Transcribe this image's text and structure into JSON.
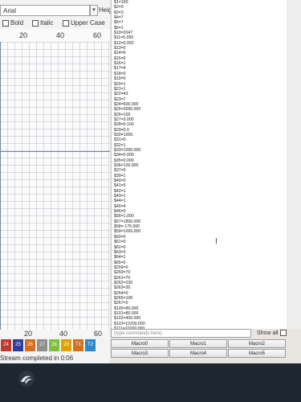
{
  "toolbar": {
    "font_value": "Arial",
    "dropdown_glyph": "▾",
    "height_label": "Heigh",
    "bold_label": "Bold",
    "italic_label": "Italic",
    "uppercase_label": "Upper Case"
  },
  "ruler": {
    "top_ticks": [
      "20",
      "40",
      "60"
    ],
    "bottom_ticks": [
      "20",
      "40",
      "60"
    ]
  },
  "tools": [
    "24",
    "25",
    "26",
    "27",
    "28",
    "29",
    "T1",
    "T2"
  ],
  "tool_colors": [
    "#c0392b",
    "#2d3e9e",
    "#d96b1d",
    "#8e8e8e",
    "#7fbf3f",
    "#e0a000",
    "#d07020",
    "#2f89c9"
  ],
  "status": "Stream completed in 0:06",
  "console": {
    "lines": [
      "$1=100",
      "$2=0",
      "$3=3",
      "$4=7",
      "$5=7",
      "$6=1",
      "$10=2047",
      "$11=0.050",
      "$12=0.002",
      "$13=0",
      "$14=6",
      "$15=0",
      "$16=1",
      "$17=4",
      "$18=0",
      "$19=0",
      "$20=1",
      "$21=1",
      "$22=43",
      "$23=7",
      "$24=600.000",
      "$25=3000.000",
      "$26=100",
      "$27=3.000",
      "$28=0.100",
      "$29=0.0",
      "$30=1000.",
      "$31=0.",
      "$32=1",
      "$33=1000.000",
      "$34=0.000",
      "$35=0.000",
      "$36=100.000",
      "$37=0",
      "$39=1",
      "$40=0",
      "$41=0",
      "$42=1",
      "$43=1",
      "$44=1",
      "$45=4",
      "$46=0",
      "$56=1.000",
      "$57=1800.000",
      "$58=-175.000",
      "$59=1000.000",
      "$60=0",
      "$61=0",
      "$62=0",
      "$63=3",
      "$64=1",
      "$65=0",
      "$259=0",
      "$260=70",
      "$261=70",
      "$262=230",
      "$263=30",
      "$264=0",
      "$265=100",
      "$267=0",
      "$100=80.000",
      "$101=80.000",
      "$102=400.000",
      "$110=10200.000",
      "$111=10200.000",
      "$112=1200.000",
      "$120=2200.000",
      "$121=1800.000",
      "$122=2000.000",
      "$130=180.000",
      "$131=180.000",
      "$132=100.000"
    ],
    "input_placeholder": "(type commands here)",
    "show_all_label": "Show all"
  },
  "macros": [
    "Macro0",
    "Macro1",
    "Macro2",
    "Macro3",
    "Macro4",
    "Macro5"
  ]
}
